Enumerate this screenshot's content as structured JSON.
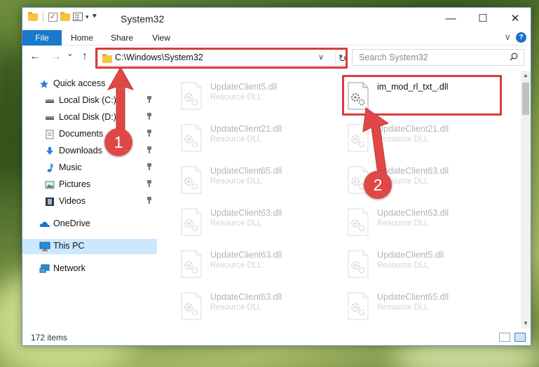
{
  "window": {
    "title": "System32",
    "controls": {
      "minimize": "—",
      "maximize": "☐",
      "close": "✕"
    }
  },
  "ribbon": {
    "tabs": [
      "File",
      "Home",
      "Share",
      "View"
    ],
    "help": "?",
    "expand": "∨"
  },
  "nav": {
    "back": "←",
    "forward": "→",
    "recent": "⌄",
    "up": "↑",
    "address": "C:\\Windows\\System32",
    "address_drop": "∨",
    "refresh": "↻",
    "search_placeholder": "Search System32"
  },
  "sidebar": {
    "items": [
      {
        "label": "Quick access",
        "icon": "star-icon",
        "pinned": false
      },
      {
        "label": "Local Disk (C:)",
        "icon": "drive-icon",
        "pinned": true
      },
      {
        "label": "Local Disk (D:)",
        "icon": "drive-icon",
        "pinned": true
      },
      {
        "label": "Documents",
        "icon": "documents-icon",
        "pinned": true
      },
      {
        "label": "Downloads",
        "icon": "download-icon",
        "pinned": true
      },
      {
        "label": "Music",
        "icon": "music-icon",
        "pinned": true
      },
      {
        "label": "Pictures",
        "icon": "pictures-icon",
        "pinned": true
      },
      {
        "label": "Videos",
        "icon": "videos-icon",
        "pinned": true
      },
      {
        "label": "OneDrive",
        "icon": "cloud-icon",
        "pinned": false
      },
      {
        "label": "This PC",
        "icon": "computer-icon",
        "pinned": false,
        "selected": true
      },
      {
        "label": "Network",
        "icon": "network-icon",
        "pinned": false
      }
    ]
  },
  "files": {
    "highlighted": {
      "name": "im_mod_rl_txt_.dll"
    },
    "left_column": [
      {
        "name": "UpdateClient5.dll",
        "type": "Resource DLL"
      },
      {
        "name": "UpdateClient21.dll",
        "type": "Resource DLL"
      },
      {
        "name": "UpdateClient65.dll",
        "type": "Resource DLL"
      },
      {
        "name": "UpdateClient63.dll",
        "type": "Resource DLL"
      },
      {
        "name": "UpdateClient63.dll",
        "type": "Resource DLL"
      },
      {
        "name": "UpdateClient63.dll",
        "type": "Resource DLL"
      }
    ],
    "right_column": [
      {
        "name": "UpdateClient21.dll",
        "type": "Resource DLL"
      },
      {
        "name": "UpdateClient63.dll",
        "type": "Resource DLL"
      },
      {
        "name": "UpdateClient63.dll",
        "type": "Resource DLL"
      },
      {
        "name": "UpdateClient5.dll",
        "type": "Resource DLL"
      },
      {
        "name": "UpdateClient65.dll",
        "type": "Resource DLL"
      }
    ]
  },
  "status": {
    "item_count": "172 items"
  },
  "callouts": {
    "step1": "1",
    "step2": "2",
    "color": "#e04848"
  }
}
